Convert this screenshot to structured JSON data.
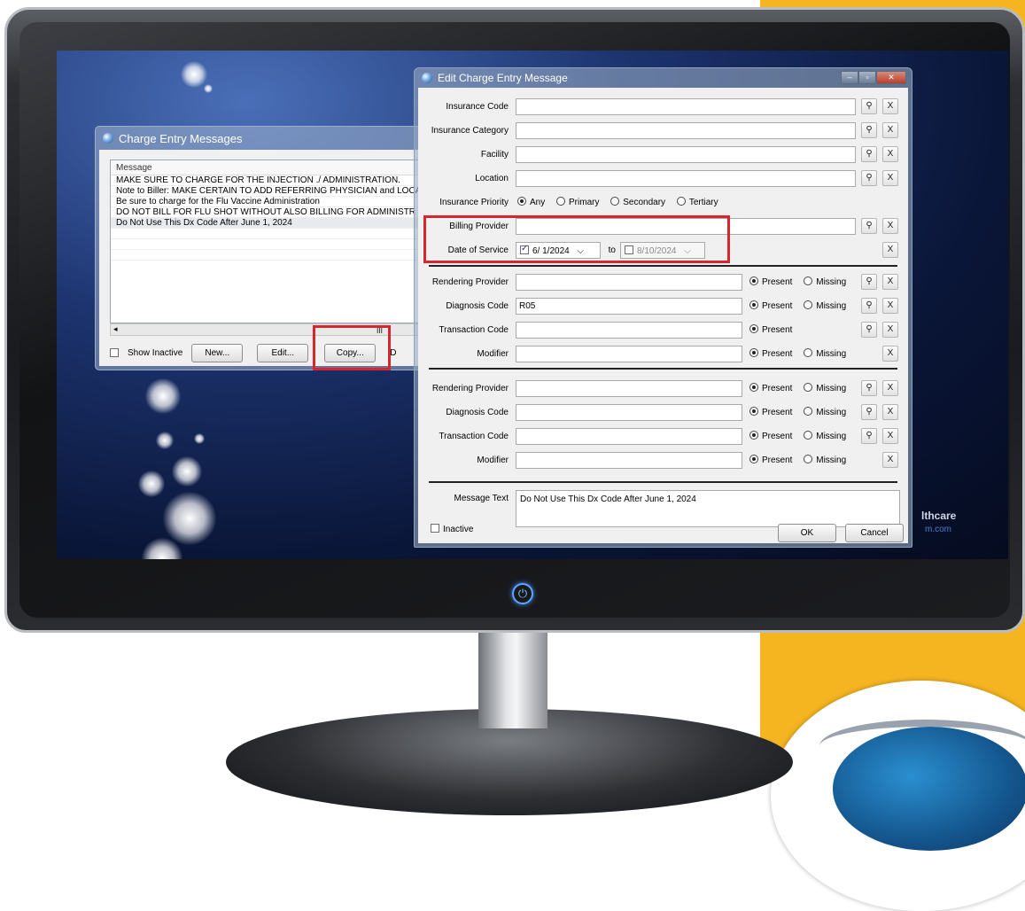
{
  "charge_entry_messages": {
    "title": "Charge Entry Messages",
    "column_header": "Message",
    "messages": [
      "MAKE SURE TO CHARGE FOR THE INJECTION ./ ADMINISTRATION.",
      "Note to Biller: MAKE CERTAIN TO ADD REFERRING PHYSICIAN and LOCA",
      "Be sure to charge for the Flu Vaccine Administration",
      "DO NOT BILL FOR FLU SHOT WITHOUT ALSO BILLING FOR ADMINISTR",
      "Do Not Use This Dx Code After June 1, 2024"
    ],
    "show_inactive_label": "Show Inactive",
    "new_label": "New...",
    "edit_label": "Edit...",
    "copy_label": "Copy...",
    "cut_off_label": "D"
  },
  "edit_window": {
    "title": "Edit Charge Entry Message",
    "insurance_code_label": "Insurance Code",
    "insurance_category_label": "Insurance Category",
    "facility_label": "Facility",
    "location_label": "Location",
    "insurance_priority_label": "Insurance Priority",
    "priority_options": [
      "Any",
      "Primary",
      "Secondary",
      "Tertiary"
    ],
    "billing_provider_label": "Billing Provider",
    "date_of_service_label": "Date of Service",
    "date_from": "6/ 1/2024",
    "date_to_label": "to",
    "date_to": "8/10/2024",
    "section1": {
      "rendering_provider_label": "Rendering Provider",
      "diagnosis_code_label": "Diagnosis Code",
      "diagnosis_code_value": "R05",
      "transaction_code_label": "Transaction Code",
      "modifier_label": "Modifier"
    },
    "section2": {
      "rendering_provider_label": "Rendering Provider",
      "diagnosis_code_label": "Diagnosis Code",
      "transaction_code_label": "Transaction Code",
      "modifier_label": "Modifier"
    },
    "present_label": "Present",
    "missing_label": "Missing",
    "message_text_label": "Message Text",
    "message_text_value": "Do Not Use This Dx Code After June 1, 2024",
    "inactive_label": "Inactive",
    "ok_label": "OK",
    "cancel_label": "Cancel"
  },
  "icons": {
    "search": "search-icon",
    "clear": "X",
    "dropdown": "⌵"
  },
  "brand": {
    "partial_text": "lthcare",
    "partial_url": "m.com"
  },
  "colors": {
    "highlight": "#d7262d",
    "accent_yellow": "#f5b521"
  }
}
